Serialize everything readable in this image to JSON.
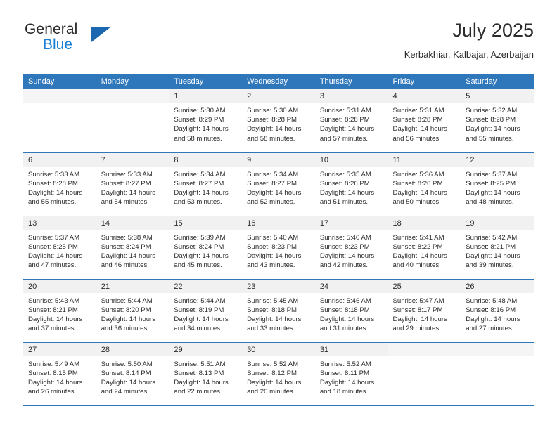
{
  "brand": {
    "name_part1": "General",
    "name_part2": "Blue",
    "logo_icon": "triangle-flag-icon"
  },
  "header": {
    "title": "July 2025",
    "subtitle": "Kerbakhiar, Kalbajar, Azerbaijan"
  },
  "colors": {
    "header_blue": "#2f77bb",
    "brand_blue": "#1b7fd4",
    "logo_blue": "#1c68b0",
    "daynum_band": "#f1f1f1",
    "text": "#2b2b2b"
  },
  "weekdays": [
    "Sunday",
    "Monday",
    "Tuesday",
    "Wednesday",
    "Thursday",
    "Friday",
    "Saturday"
  ],
  "labels": {
    "sunrise_prefix": "Sunrise:",
    "sunset_prefix": "Sunset:",
    "daylight_prefix": "Daylight:"
  },
  "weeks": [
    [
      {
        "day": "",
        "sunrise": "",
        "sunset": "",
        "daylight": ""
      },
      {
        "day": "",
        "sunrise": "",
        "sunset": "",
        "daylight": ""
      },
      {
        "day": "1",
        "sunrise": "Sunrise: 5:30 AM",
        "sunset": "Sunset: 8:29 PM",
        "daylight": "Daylight: 14 hours and 58 minutes."
      },
      {
        "day": "2",
        "sunrise": "Sunrise: 5:30 AM",
        "sunset": "Sunset: 8:28 PM",
        "daylight": "Daylight: 14 hours and 58 minutes."
      },
      {
        "day": "3",
        "sunrise": "Sunrise: 5:31 AM",
        "sunset": "Sunset: 8:28 PM",
        "daylight": "Daylight: 14 hours and 57 minutes."
      },
      {
        "day": "4",
        "sunrise": "Sunrise: 5:31 AM",
        "sunset": "Sunset: 8:28 PM",
        "daylight": "Daylight: 14 hours and 56 minutes."
      },
      {
        "day": "5",
        "sunrise": "Sunrise: 5:32 AM",
        "sunset": "Sunset: 8:28 PM",
        "daylight": "Daylight: 14 hours and 55 minutes."
      }
    ],
    [
      {
        "day": "6",
        "sunrise": "Sunrise: 5:33 AM",
        "sunset": "Sunset: 8:28 PM",
        "daylight": "Daylight: 14 hours and 55 minutes."
      },
      {
        "day": "7",
        "sunrise": "Sunrise: 5:33 AM",
        "sunset": "Sunset: 8:27 PM",
        "daylight": "Daylight: 14 hours and 54 minutes."
      },
      {
        "day": "8",
        "sunrise": "Sunrise: 5:34 AM",
        "sunset": "Sunset: 8:27 PM",
        "daylight": "Daylight: 14 hours and 53 minutes."
      },
      {
        "day": "9",
        "sunrise": "Sunrise: 5:34 AM",
        "sunset": "Sunset: 8:27 PM",
        "daylight": "Daylight: 14 hours and 52 minutes."
      },
      {
        "day": "10",
        "sunrise": "Sunrise: 5:35 AM",
        "sunset": "Sunset: 8:26 PM",
        "daylight": "Daylight: 14 hours and 51 minutes."
      },
      {
        "day": "11",
        "sunrise": "Sunrise: 5:36 AM",
        "sunset": "Sunset: 8:26 PM",
        "daylight": "Daylight: 14 hours and 50 minutes."
      },
      {
        "day": "12",
        "sunrise": "Sunrise: 5:37 AM",
        "sunset": "Sunset: 8:25 PM",
        "daylight": "Daylight: 14 hours and 48 minutes."
      }
    ],
    [
      {
        "day": "13",
        "sunrise": "Sunrise: 5:37 AM",
        "sunset": "Sunset: 8:25 PM",
        "daylight": "Daylight: 14 hours and 47 minutes."
      },
      {
        "day": "14",
        "sunrise": "Sunrise: 5:38 AM",
        "sunset": "Sunset: 8:24 PM",
        "daylight": "Daylight: 14 hours and 46 minutes."
      },
      {
        "day": "15",
        "sunrise": "Sunrise: 5:39 AM",
        "sunset": "Sunset: 8:24 PM",
        "daylight": "Daylight: 14 hours and 45 minutes."
      },
      {
        "day": "16",
        "sunrise": "Sunrise: 5:40 AM",
        "sunset": "Sunset: 8:23 PM",
        "daylight": "Daylight: 14 hours and 43 minutes."
      },
      {
        "day": "17",
        "sunrise": "Sunrise: 5:40 AM",
        "sunset": "Sunset: 8:23 PM",
        "daylight": "Daylight: 14 hours and 42 minutes."
      },
      {
        "day": "18",
        "sunrise": "Sunrise: 5:41 AM",
        "sunset": "Sunset: 8:22 PM",
        "daylight": "Daylight: 14 hours and 40 minutes."
      },
      {
        "day": "19",
        "sunrise": "Sunrise: 5:42 AM",
        "sunset": "Sunset: 8:21 PM",
        "daylight": "Daylight: 14 hours and 39 minutes."
      }
    ],
    [
      {
        "day": "20",
        "sunrise": "Sunrise: 5:43 AM",
        "sunset": "Sunset: 8:21 PM",
        "daylight": "Daylight: 14 hours and 37 minutes."
      },
      {
        "day": "21",
        "sunrise": "Sunrise: 5:44 AM",
        "sunset": "Sunset: 8:20 PM",
        "daylight": "Daylight: 14 hours and 36 minutes."
      },
      {
        "day": "22",
        "sunrise": "Sunrise: 5:44 AM",
        "sunset": "Sunset: 8:19 PM",
        "daylight": "Daylight: 14 hours and 34 minutes."
      },
      {
        "day": "23",
        "sunrise": "Sunrise: 5:45 AM",
        "sunset": "Sunset: 8:18 PM",
        "daylight": "Daylight: 14 hours and 33 minutes."
      },
      {
        "day": "24",
        "sunrise": "Sunrise: 5:46 AM",
        "sunset": "Sunset: 8:18 PM",
        "daylight": "Daylight: 14 hours and 31 minutes."
      },
      {
        "day": "25",
        "sunrise": "Sunrise: 5:47 AM",
        "sunset": "Sunset: 8:17 PM",
        "daylight": "Daylight: 14 hours and 29 minutes."
      },
      {
        "day": "26",
        "sunrise": "Sunrise: 5:48 AM",
        "sunset": "Sunset: 8:16 PM",
        "daylight": "Daylight: 14 hours and 27 minutes."
      }
    ],
    [
      {
        "day": "27",
        "sunrise": "Sunrise: 5:49 AM",
        "sunset": "Sunset: 8:15 PM",
        "daylight": "Daylight: 14 hours and 26 minutes."
      },
      {
        "day": "28",
        "sunrise": "Sunrise: 5:50 AM",
        "sunset": "Sunset: 8:14 PM",
        "daylight": "Daylight: 14 hours and 24 minutes."
      },
      {
        "day": "29",
        "sunrise": "Sunrise: 5:51 AM",
        "sunset": "Sunset: 8:13 PM",
        "daylight": "Daylight: 14 hours and 22 minutes."
      },
      {
        "day": "30",
        "sunrise": "Sunrise: 5:52 AM",
        "sunset": "Sunset: 8:12 PM",
        "daylight": "Daylight: 14 hours and 20 minutes."
      },
      {
        "day": "31",
        "sunrise": "Sunrise: 5:52 AM",
        "sunset": "Sunset: 8:11 PM",
        "daylight": "Daylight: 14 hours and 18 minutes."
      },
      {
        "day": "",
        "sunrise": "",
        "sunset": "",
        "daylight": ""
      },
      {
        "day": "",
        "sunrise": "",
        "sunset": "",
        "daylight": ""
      }
    ]
  ]
}
